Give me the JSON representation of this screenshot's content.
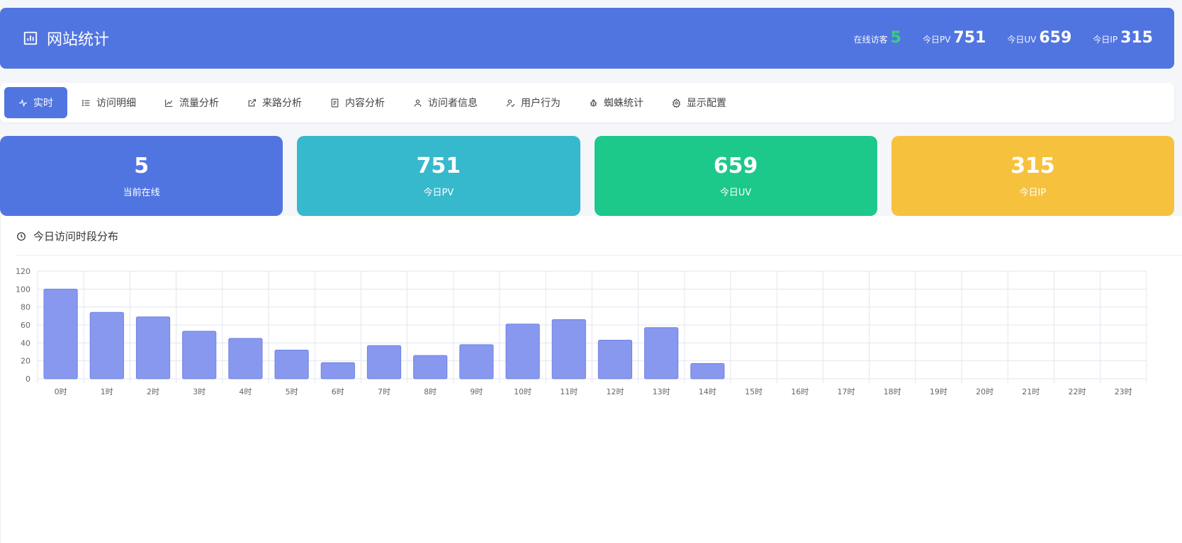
{
  "header": {
    "title": "网站统计",
    "stats": [
      {
        "label": "在线访客",
        "value": "5",
        "highlight": true
      },
      {
        "label": "今日PV",
        "value": "751"
      },
      {
        "label": "今日UV",
        "value": "659"
      },
      {
        "label": "今日IP",
        "value": "315"
      }
    ]
  },
  "tabs": [
    {
      "label": "实时",
      "icon": "pulse-icon",
      "active": true
    },
    {
      "label": "访问明细",
      "icon": "list-icon"
    },
    {
      "label": "流量分析",
      "icon": "line-chart-icon"
    },
    {
      "label": "来路分析",
      "icon": "external-link-icon"
    },
    {
      "label": "内容分析",
      "icon": "document-icon"
    },
    {
      "label": "访问者信息",
      "icon": "user-icon"
    },
    {
      "label": "用户行为",
      "icon": "user-check-icon"
    },
    {
      "label": "蜘蛛统计",
      "icon": "bug-icon"
    },
    {
      "label": "显示配置",
      "icon": "gear-icon"
    }
  ],
  "cards": [
    {
      "value": "5",
      "label": "当前在线",
      "color": "#5175e0"
    },
    {
      "value": "751",
      "label": "今日PV",
      "color": "#36b9cc"
    },
    {
      "value": "659",
      "label": "今日UV",
      "color": "#1cc88a"
    },
    {
      "value": "315",
      "label": "今日IP",
      "color": "#f6c23e"
    }
  ],
  "panel": {
    "title": "今日访问时段分布"
  },
  "chart_data": {
    "type": "bar",
    "categories": [
      "0时",
      "1时",
      "2时",
      "3时",
      "4时",
      "5时",
      "6时",
      "7时",
      "8时",
      "9时",
      "10时",
      "11时",
      "12时",
      "13时",
      "14时",
      "15时",
      "16时",
      "17时",
      "18时",
      "19时",
      "20时",
      "21时",
      "22时",
      "23时"
    ],
    "values": [
      100,
      74,
      69,
      53,
      45,
      32,
      18,
      37,
      26,
      38,
      61,
      66,
      43,
      57,
      17,
      0,
      0,
      0,
      0,
      0,
      0,
      0,
      0,
      0
    ],
    "yticks": [
      0,
      20,
      40,
      60,
      80,
      100,
      120
    ],
    "ylim": [
      0,
      120
    ],
    "grid": true,
    "bar_color": "#8798ee"
  }
}
